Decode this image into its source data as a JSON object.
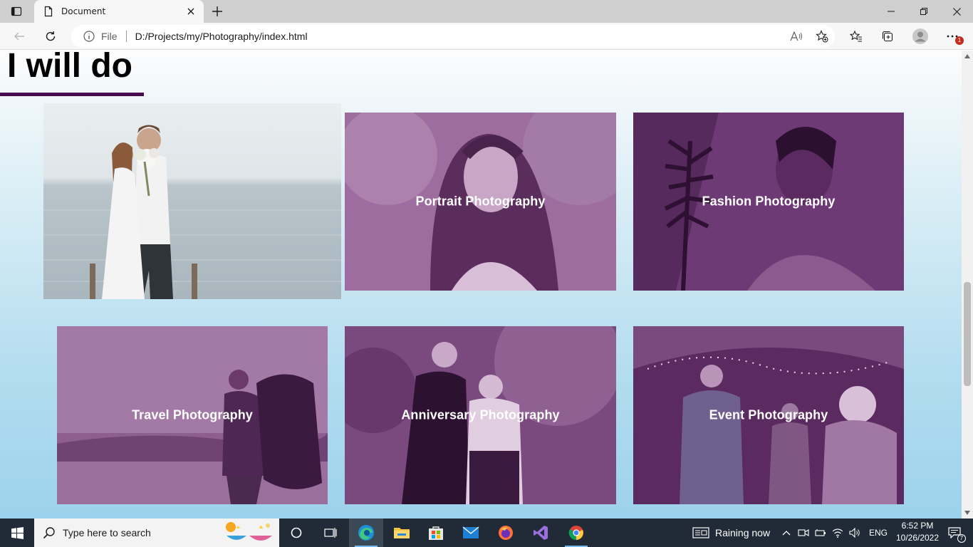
{
  "browser": {
    "tab_title": "Document",
    "address_scheme": "File",
    "address_url": "D:/Projects/my/Photography/index.html",
    "notification_badge": "1"
  },
  "page": {
    "heading": "I will do",
    "accent_color": "#4a0a4e",
    "overlay_color": "#6e3a76",
    "cards": [
      {
        "label": "",
        "photo": "wedding-couple-photo"
      },
      {
        "label": "Portrait Photography",
        "photo": "portrait-photo"
      },
      {
        "label": "Fashion Photography",
        "photo": "fashion-photo"
      },
      {
        "label": "Travel Photography",
        "photo": "travel-photo"
      },
      {
        "label": "Anniversary Photography",
        "photo": "anniversary-photo"
      },
      {
        "label": "Event Photography",
        "photo": "event-photo"
      }
    ]
  },
  "taskbar": {
    "search_placeholder": "Type here to search",
    "weather": "Raining now",
    "language": "ENG",
    "time": "6:52 PM",
    "date": "10/26/2022",
    "notification_count": "7",
    "apps": [
      "task-view",
      "edge",
      "file-explorer",
      "microsoft-store",
      "mail",
      "firefox",
      "visual-studio",
      "chrome"
    ]
  }
}
